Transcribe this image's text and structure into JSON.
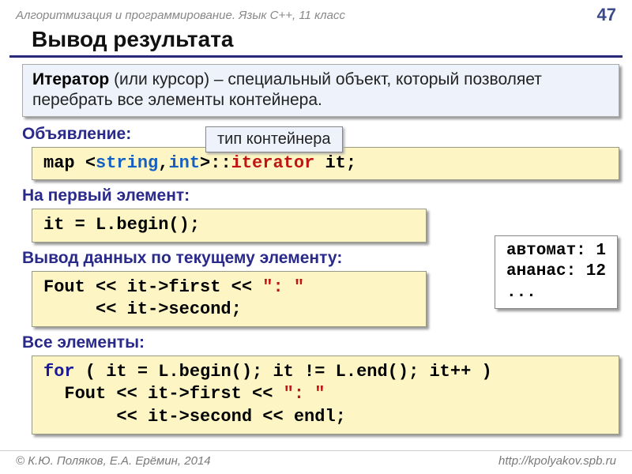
{
  "header": {
    "title": "Алгоритмизация и программирование. Язык C++, 11 класс",
    "page": "47"
  },
  "title": "Вывод результата",
  "definition": {
    "term": "Итератор",
    "rest": " (или курсор) – специальный объект, который позволяет перебрать все элементы контейнера."
  },
  "sections": {
    "decl": "Объявление:",
    "first": "На первый элемент:",
    "current": "Вывод данных по текущему элементу:",
    "all": "Все элементы:"
  },
  "callout": "тип контейнера",
  "code": {
    "decl_map": "map ",
    "decl_lt": "<",
    "decl_string": "string",
    "decl_comma": ",",
    "decl_int": "int",
    "decl_gt": ">",
    "decl_colon": "::",
    "decl_iterator": "iterator",
    "decl_it": " it;",
    "first": "it = L.begin();",
    "current_l1a": "Fout << it->first << ",
    "current_str": "\": \"",
    "current_l2": "     << it->second;",
    "all_l1a": "for",
    "all_l1b": " ( it = L.begin(); it != L.end(); it++ )",
    "all_l2a": "  Fout << it->first << ",
    "all_l2str": "\": \"",
    "all_l3": "       << it->second << endl;"
  },
  "output": "автомат: 1\nананас: 12\n...",
  "footer": {
    "authors": "© К.Ю. Поляков, Е.А. Ерёмин, 2014",
    "url": "http://kpolyakov.spb.ru"
  }
}
